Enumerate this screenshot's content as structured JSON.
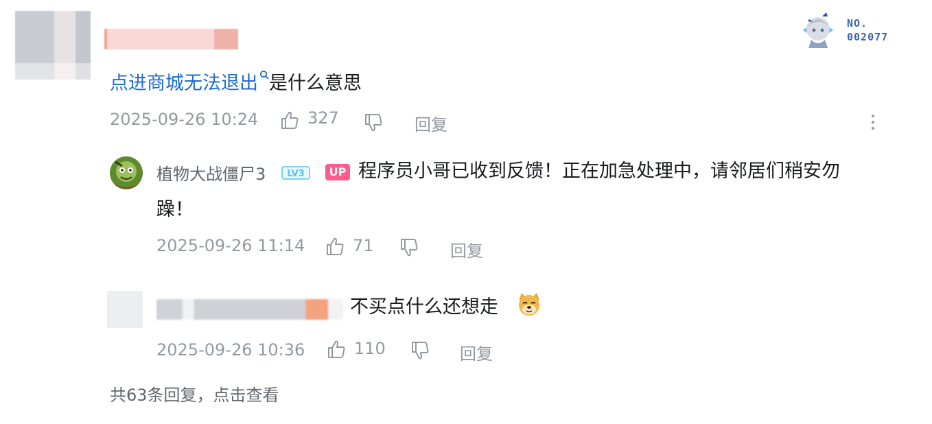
{
  "comment": {
    "link_text": "点进商城无法退出",
    "rest_text": "是什么意思",
    "time": "2025-09-26 10:24",
    "likes": "327",
    "reply_label": "回复"
  },
  "nft_badge": {
    "line1": "NO.",
    "line2": "002077"
  },
  "replies": [
    {
      "user": "植物大战僵尸3",
      "level": "LV3",
      "up_badge": "UP",
      "text_line1": "程序员小哥已收到反馈！正在加急处理中，请邻居们稍安勿",
      "text_line2": "躁！",
      "time": "2025-09-26 11:14",
      "likes": "71",
      "reply_label": "回复"
    },
    {
      "text": "不买点什么还想走",
      "emoji": "doge-icon",
      "time": "2025-09-26 10:36",
      "likes": "110",
      "reply_label": "回复"
    }
  ],
  "footer": {
    "more_replies": "共63条回复，点击查看"
  },
  "colors": {
    "link": "#1e6bd6",
    "meta": "#9499a0",
    "up_badge": "#ff5c8e",
    "level_badge": "#52c6f0"
  }
}
